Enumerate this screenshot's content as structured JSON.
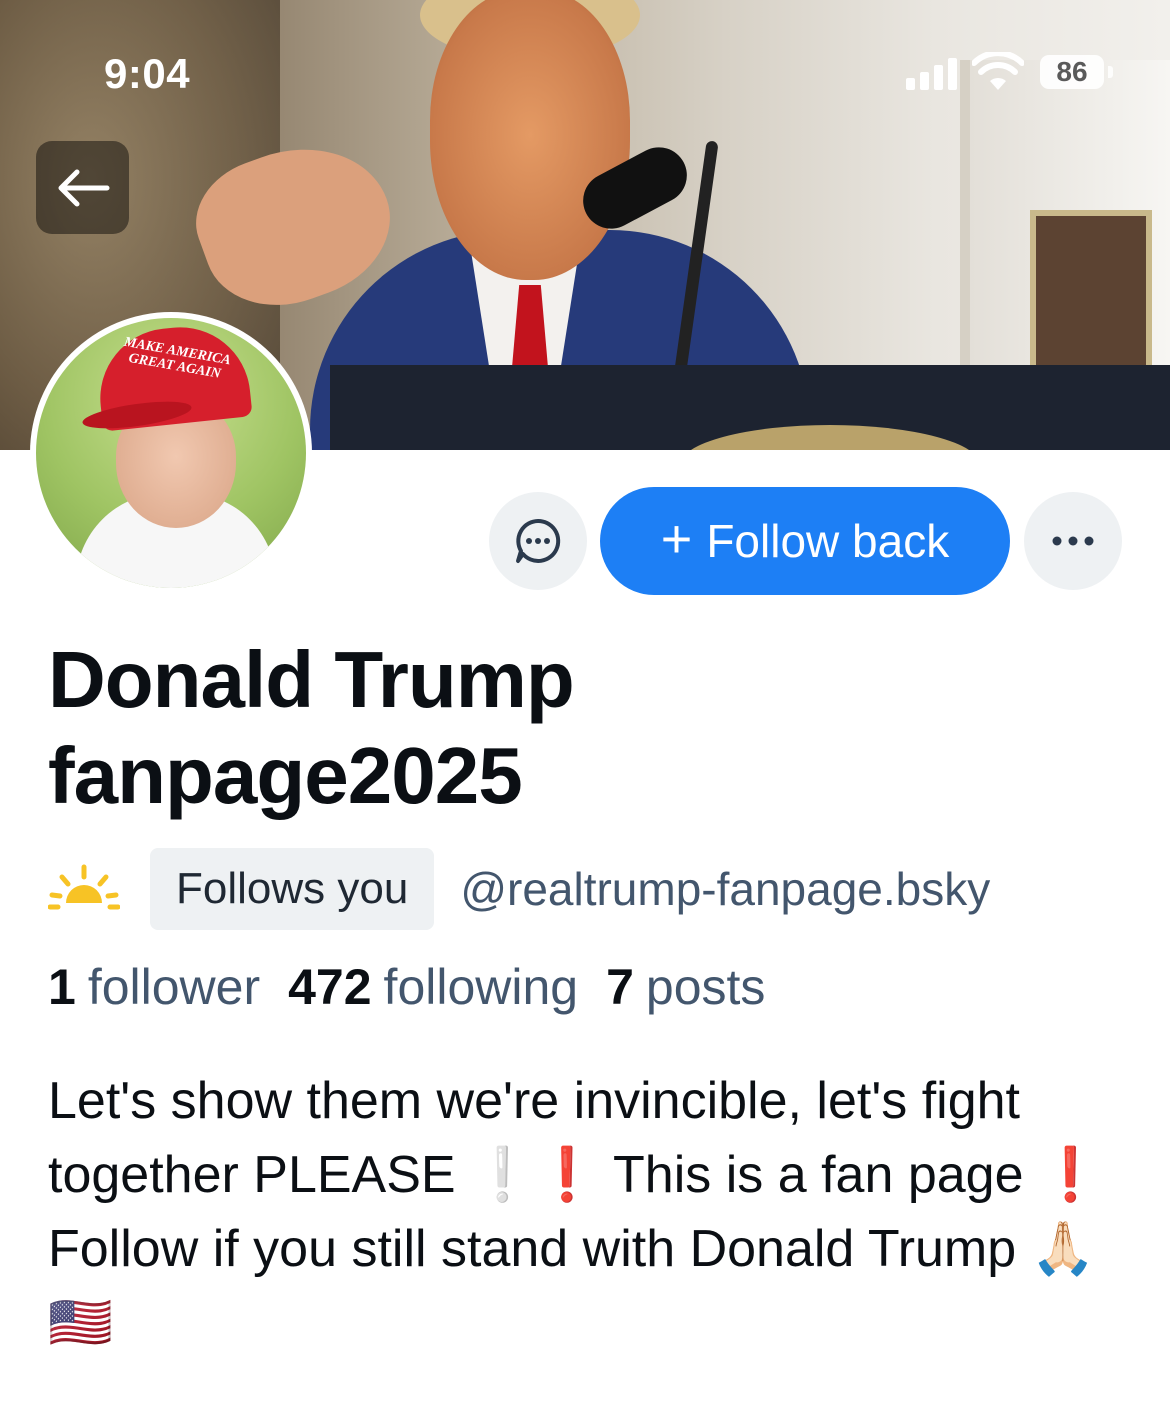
{
  "status_bar": {
    "time": "9:04",
    "battery": "86"
  },
  "profile": {
    "display_name": "Donald Trump fanpage2025",
    "follows_you": "Follows you",
    "handle": "@realtrump-fanpage.bsky",
    "avatar_cap_text": "MAKE AMERICA GREAT AGAIN",
    "stats": {
      "followers_count": "1",
      "followers_label": "follower",
      "following_count": "472",
      "following_label": "following",
      "posts_count": "7",
      "posts_label": "posts"
    },
    "bio": "Let's show them we're invincible, let's fight together PLEASE ❕❗️ This is a fan page ❗️ Follow if you still stand with Donald Trump 🙏🏻🇺🇸"
  },
  "actions": {
    "follow_back_label": "Follow back",
    "follow_plus": "+"
  },
  "icons": {
    "back": "arrow-left-icon",
    "message": "chat-bubble-icon",
    "more": "ellipsis-icon",
    "weather": "sunrise-icon"
  },
  "colors": {
    "accent": "#1d7ff5",
    "muted_text": "#43566d",
    "button_bg": "#eef1f3"
  }
}
